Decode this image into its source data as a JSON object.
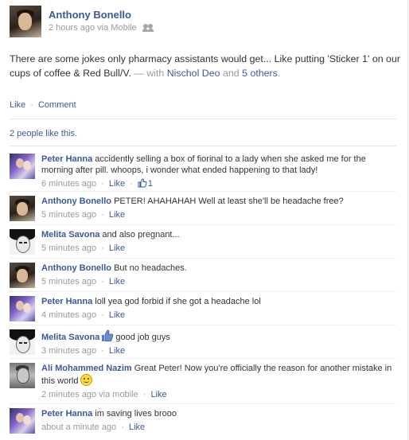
{
  "post": {
    "author": "Anthony Bonello",
    "time": "2 hours ago",
    "via": "via Mobile",
    "text": "There are some jokes only pharmacy assistants would get... Like putting 'Sticker 1' on our cups of coffee & Red Bull/V.",
    "with_prefix": "— with",
    "tagged_person": "Nischol Deo",
    "and_text": "and",
    "others": "5 others",
    "period": "."
  },
  "actions": {
    "like": "Like",
    "comment": "Comment"
  },
  "likes_summary": "2 people like this.",
  "comments": [
    {
      "name": "Peter Hanna",
      "text": "accidently selling a box of fiorinal to a lady when she asked me for the morning after pill. whoops, i wonder what ended happening to that lady!",
      "time": "6 minutes ago",
      "like": "Like",
      "like_count": "1"
    },
    {
      "name": "Anthony Bonello",
      "text": "PETER! AHAHAHAH Well at least she'll be headache free?",
      "time": "5 minutes ago",
      "like": "Like"
    },
    {
      "name": "Melita Savona",
      "text": "and also pregnant...",
      "time": "5 minutes ago",
      "like": "Like"
    },
    {
      "name": "Anthony Bonello",
      "text": "But no headaches.",
      "time": "5 minutes ago",
      "like": "Like"
    },
    {
      "name": "Peter Hanna",
      "text": "loll yea god forbid if she got a headache lol",
      "time": "4 minutes ago",
      "like": "Like"
    },
    {
      "name": "Melita Savona",
      "text": "good job guys",
      "time": "3 minutes ago",
      "like": "Like"
    },
    {
      "name": "Ali Mohammed Nazim",
      "text": "Great Peter! Now you're officially the reason for another mistake in this world",
      "time": "2 minutes ago",
      "via": "via mobile",
      "like": "Like"
    },
    {
      "name": "Peter Hanna",
      "text": "im saving lives brooo",
      "time": "about a minute ago",
      "like": "Like"
    }
  ],
  "colors": {
    "link": "#3b5998",
    "meta": "#999999",
    "text": "#333333"
  },
  "icons": [
    "friends-icon",
    "thumbs-up-icon",
    "smiley-icon"
  ]
}
